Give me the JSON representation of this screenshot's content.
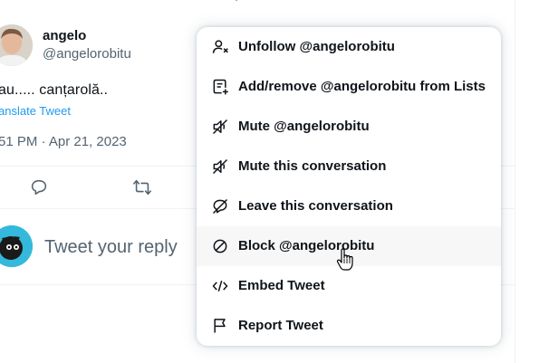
{
  "author": {
    "name": "angelo",
    "handle": "@angelorobitu"
  },
  "tweet": {
    "text": "au..... canțarolă..",
    "translate_label": "anslate Tweet",
    "timestamp": "51 PM · Apr 21, 2023"
  },
  "reply": {
    "placeholder": "Tweet your reply"
  },
  "menu": {
    "items": [
      {
        "label": "Unfollow @angelorobitu",
        "icon": "unfollow-icon"
      },
      {
        "label": "Add/remove @angelorobitu from Lists",
        "icon": "list-add-icon"
      },
      {
        "label": "Mute @angelorobitu",
        "icon": "mute-icon"
      },
      {
        "label": "Mute this conversation",
        "icon": "mute-conversation-icon"
      },
      {
        "label": "Leave this conversation",
        "icon": "leave-conversation-icon"
      },
      {
        "label": "Block @angelorobitu",
        "icon": "block-icon"
      },
      {
        "label": "Embed Tweet",
        "icon": "embed-icon"
      },
      {
        "label": "Report Tweet",
        "icon": "flag-icon"
      }
    ],
    "hovered_item": "Block @angelorobitu"
  },
  "colors": {
    "accent": "#1d9bf0",
    "text": "#0f1419",
    "secondary_text": "#536471",
    "divider": "#eff3f4",
    "hover": "#f7f7f7"
  }
}
